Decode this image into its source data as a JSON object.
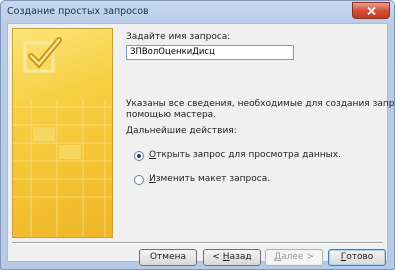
{
  "window": {
    "title": "Создание простых запросов"
  },
  "form": {
    "name_label": "Задайте имя запроса:",
    "name_value": "ЗПВолОценкиДисц",
    "info_line1": "Указаны все сведения, необходимые для создания запроса с",
    "info_line2": "помощью мастера.",
    "next_actions_label": "Дальнейшие действия:",
    "options": [
      {
        "pre": "",
        "mnemonic": "О",
        "post": "ткрыть запрос для просмотра данных.",
        "checked": true
      },
      {
        "pre": "",
        "mnemonic": "И",
        "post": "зменить макет запроса.",
        "checked": false
      }
    ]
  },
  "buttons": {
    "cancel": {
      "pre": "Отмена",
      "mnemonic": "",
      "post": ""
    },
    "back": {
      "pre": "< ",
      "mnemonic": "Н",
      "post": "азад"
    },
    "next": {
      "pre": "",
      "mnemonic": "Д",
      "post": "алее >"
    },
    "finish": {
      "pre": "",
      "mnemonic": "Г",
      "post": "отово"
    }
  },
  "icons": {
    "close": "close-icon",
    "art": "checkmark-grid-illustration"
  },
  "colors": {
    "art_yellow": "#f6cf41",
    "close_red": "#d3513a",
    "titlebar": "#c8d9ef"
  }
}
